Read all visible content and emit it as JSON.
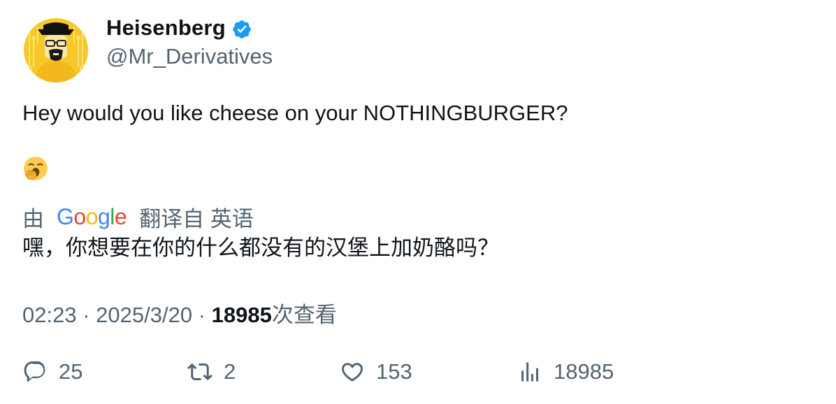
{
  "author": {
    "display_name": "Heisenberg",
    "handle": "@Mr_Derivatives",
    "verified": true,
    "avatar": "heisenberg-avatar"
  },
  "tweet": {
    "text": "Hey would you like cheese on your NOTHINGBURGER?",
    "emoji": "🥱"
  },
  "translation": {
    "prefix": "由",
    "provider_letters": [
      "G",
      "o",
      "o",
      "g",
      "l",
      "e"
    ],
    "provider_colors": [
      "#4285F4",
      "#EA4335",
      "#FBBC05",
      "#4285F4",
      "#34A853",
      "#EA4335"
    ],
    "suffix": "翻译自 英语",
    "text": "嘿，你想要在你的什么都没有的汉堡上加奶酪吗？"
  },
  "meta": {
    "time": "02:23",
    "separator": "·",
    "date": "2025/3/20",
    "views_count": "18985",
    "views_label": "次查看"
  },
  "actions": {
    "replies": "25",
    "retweets": "2",
    "likes": "153",
    "views": "18985"
  },
  "colors": {
    "text": "#0f1419",
    "secondary": "#536471",
    "verified": "#1d9bf0",
    "avatar_bg": "#f6c928"
  }
}
